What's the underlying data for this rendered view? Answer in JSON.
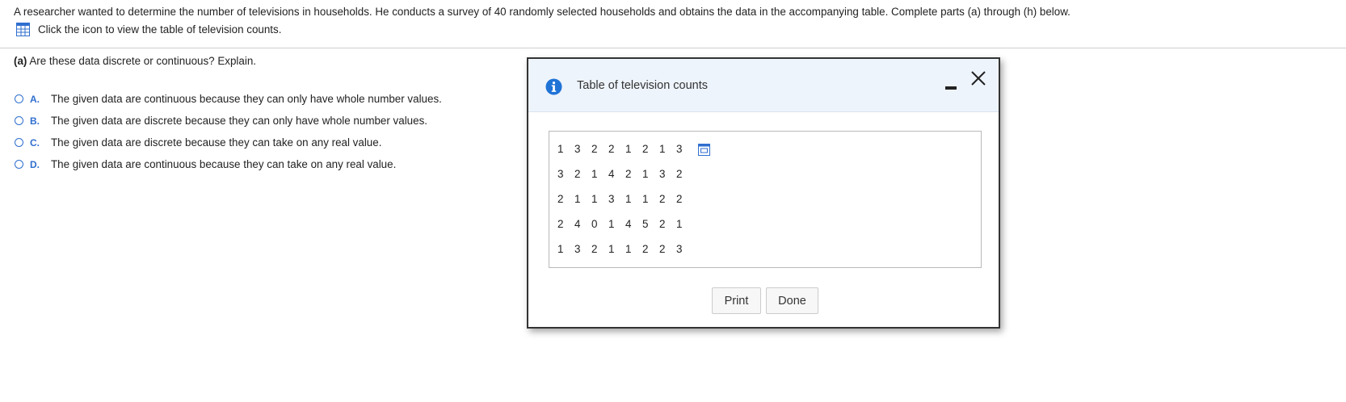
{
  "intro": {
    "text": "A researcher wanted to determine the number of televisions in households. He conducts a survey of 40 randomly selected households and obtains the data in the accompanying table. Complete parts (a) through (h) below.",
    "icon_link_text": "Click the icon to view the table of television counts."
  },
  "question": {
    "part": "(a)",
    "text": "Are these data discrete or continuous? Explain."
  },
  "options": [
    {
      "letter": "A.",
      "text": "The given data are continuous because they can only have whole number values."
    },
    {
      "letter": "B.",
      "text": "The given data are discrete because they can only have whole number values."
    },
    {
      "letter": "C.",
      "text": "The given data are discrete because they can take on any real value."
    },
    {
      "letter": "D.",
      "text": "The given data are continuous because they can take on any real value."
    }
  ],
  "modal": {
    "title": "Table of television counts",
    "rows": [
      [
        "1",
        "3",
        "2",
        "2",
        "1",
        "2",
        "1",
        "3"
      ],
      [
        "3",
        "2",
        "1",
        "4",
        "2",
        "1",
        "3",
        "2"
      ],
      [
        "2",
        "1",
        "1",
        "3",
        "1",
        "1",
        "2",
        "2"
      ],
      [
        "2",
        "4",
        "0",
        "1",
        "4",
        "5",
        "2",
        "1"
      ],
      [
        "1",
        "3",
        "2",
        "1",
        "1",
        "2",
        "2",
        "3"
      ]
    ],
    "print_label": "Print",
    "done_label": "Done"
  },
  "colors": {
    "accent": "#2f6fcf",
    "header_bg": "#eef4fc",
    "info_icon": "#1f73d6"
  },
  "icons": {
    "table": "table-grid-icon",
    "info": "info-icon",
    "minimize": "minimize-icon",
    "close": "close-icon",
    "copy": "copy-icon"
  }
}
